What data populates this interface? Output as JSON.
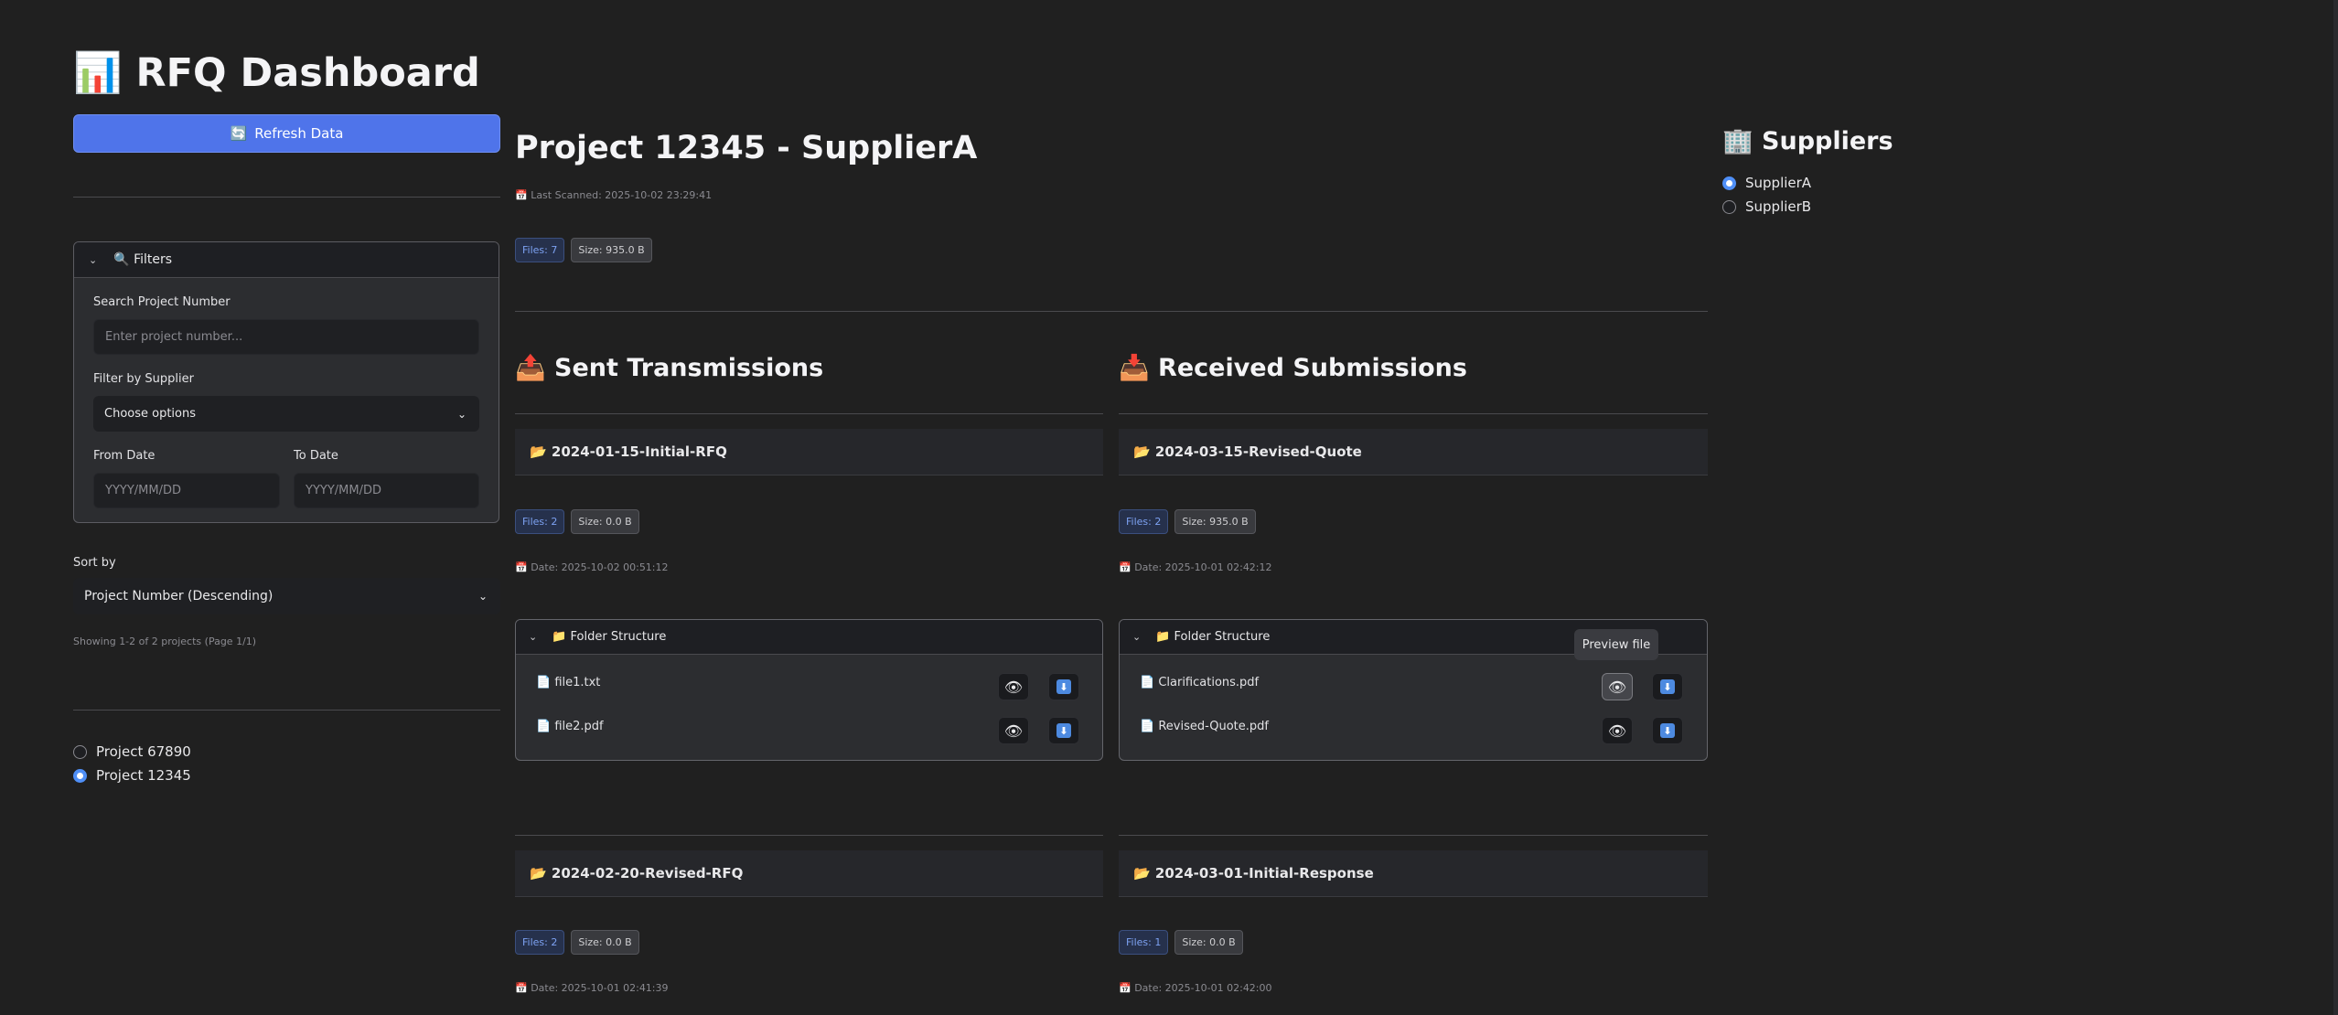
{
  "sidebar": {
    "app_title": "RFQ Dashboard",
    "app_icon": "📊",
    "refresh_label": "Refresh Data",
    "refresh_icon": "🔄",
    "filters": {
      "title": "Filters",
      "title_icon": "🔍",
      "search_label": "Search Project Number",
      "search_placeholder": "Enter project number...",
      "supplier_label": "Filter by Supplier",
      "supplier_value": "Choose options",
      "from_label": "From Date",
      "from_placeholder": "YYYY/MM/DD",
      "to_label": "To Date",
      "to_placeholder": "YYYY/MM/DD"
    },
    "sort_label": "Sort by",
    "sort_value": "Project Number (Descending)",
    "showing_text": "Showing 1-2 of 2 projects (Page 1/1)",
    "projects": [
      {
        "label": "Project 67890",
        "selected": false
      },
      {
        "label": "Project 12345",
        "selected": true
      }
    ]
  },
  "main": {
    "project_title": "Project 12345 - SupplierA",
    "last_scanned": "📅 Last Scanned: 2025-10-02 23:29:41",
    "files_badge": "Files: 7",
    "size_badge": "Size: 935.0 B",
    "sent": {
      "title": "Sent Transmissions",
      "icon": "📤",
      "folders": [
        {
          "name": "📂 2024-01-15-Initial-RFQ",
          "files_badge": "Files: 2",
          "size_badge": "Size: 0.0 B",
          "date": "📅 Date: 2025-10-02 00:51:12",
          "structure_label": "📁 Folder Structure",
          "files": [
            "📄 file1.txt",
            "📄 file2.pdf"
          ]
        },
        {
          "name": "📂 2024-02-20-Revised-RFQ",
          "files_badge": "Files: 2",
          "size_badge": "Size: 0.0 B",
          "date": "📅 Date: 2025-10-01 02:41:39"
        }
      ]
    },
    "received": {
      "title": "Received Submissions",
      "icon": "📥",
      "folders": [
        {
          "name": "📂 2024-03-15-Revised-Quote",
          "files_badge": "Files: 2",
          "size_badge": "Size: 935.0 B",
          "date": "📅 Date: 2025-10-01 02:42:12",
          "structure_label": "📁 Folder Structure",
          "files": [
            "📄 Clarifications.pdf",
            "📄 Revised-Quote.pdf"
          ]
        },
        {
          "name": "📂 2024-03-01-Initial-Response",
          "files_badge": "Files: 1",
          "size_badge": "Size: 0.0 B",
          "date": "📅 Date: 2025-10-01 02:42:00"
        }
      ]
    },
    "tooltip": "Preview file"
  },
  "suppliers": {
    "title": "Suppliers",
    "icon": "🏢",
    "items": [
      {
        "label": "SupplierA",
        "selected": true
      },
      {
        "label": "SupplierB",
        "selected": false
      }
    ]
  },
  "colors": {
    "background": "#202020",
    "accent": "#4f74ea",
    "radio_selected": "#4f8ff7",
    "files_badge_text": "#7da2f2"
  }
}
